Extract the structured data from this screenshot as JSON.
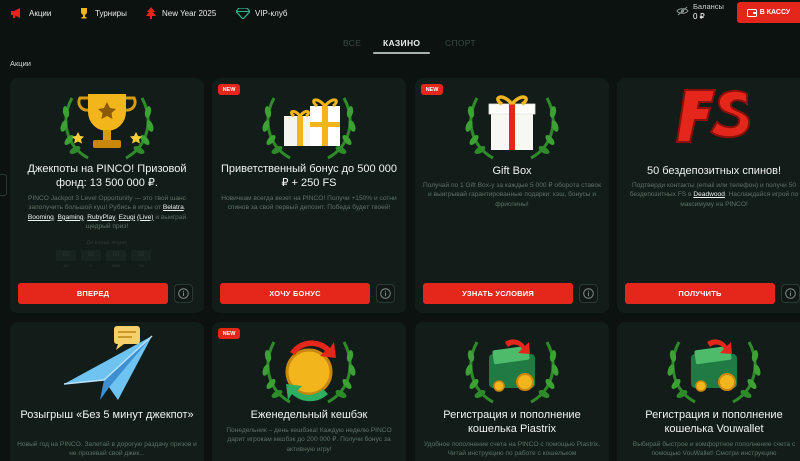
{
  "nav": {
    "items": [
      {
        "label": "Акции",
        "icon": "megaphone-icon"
      },
      {
        "label": "Турниры",
        "icon": "trophy-icon"
      },
      {
        "label": "New Year 2025",
        "icon": "christmas-tree-icon"
      },
      {
        "label": "VIP-клуб",
        "icon": "diamond-icon"
      }
    ],
    "balance_label": "Балансы",
    "balance_value": "0 ₽",
    "cashier_label": "В КАССУ"
  },
  "tabs": [
    {
      "label": "ВСЕ",
      "active": false
    },
    {
      "label": "КАЗИНО",
      "active": true
    },
    {
      "label": "СПОРТ",
      "active": false
    }
  ],
  "section_title": "Акции",
  "cards": [
    {
      "badge": "",
      "art": "gold-trophy-wreath-icon",
      "title": "Джекпоты на PINCO! Призовой фонд: 13 500 000 ₽.",
      "desc_1": "PINCO Jackpot 3 Level Opportunity — это твой шанс заполучить большой куш! Рубись в игры от",
      "links": [
        "Belatra",
        "Booming",
        "Bgaming",
        "RubyPlay",
        "Ezugi"
      ],
      "link_live": "(Live)",
      "desc_2": "и выиграй щедрый приз!",
      "ends_label": "До конца акции:",
      "timer": [
        {
          "value": "00",
          "unit": "дн"
        },
        {
          "value": "00",
          "unit": "ч"
        },
        {
          "value": "00",
          "unit": "мин"
        },
        {
          "value": "00",
          "unit": "сек"
        }
      ],
      "button": "ВПЕРЕД"
    },
    {
      "badge": "NEW",
      "art": "gift-boxes-wreath-icon",
      "title": "Приветственный бонус до 500 000 ₽ + 250 FS",
      "desc": "Новичкам всегда везет на PINCO! Получи +150% и сотни спинов за свой первый депозит. Победа будет твоей!",
      "button": "ХОЧУ БОНУС"
    },
    {
      "badge": "NEW",
      "art": "gift-box-wreath-icon",
      "title": "Gift Box",
      "desc": "Получай по 1 Gift Box-у за каждые 5 000 ₽ оборота ставок и выигрывай гарантированные подарки: кэш, бонусы и фриспины!",
      "button": "УЗНАТЬ УСЛОВИЯ"
    },
    {
      "badge": "",
      "art": "free-spins-fs-icon",
      "title": "50 бездепозитных спинов!",
      "desc": "Подтверди контакты (email или телефон) и получи 50 бездепозитных FS в",
      "link": "Deadwood",
      "desc_end": "Наслаждайся игрой по максимуму на PINCO!",
      "button": "ПОЛУЧИТЬ"
    },
    {
      "badge": "",
      "art": "paper-plane-icon",
      "title": "Розыгрыш «Без 5 минут джекпот»",
      "desc": "Новый год на PINCO. Залетай в дорогую раздачу призов и не прозевай свой джек..."
    },
    {
      "badge": "NEW",
      "art": "cashback-coin-wreath-icon",
      "title": "Еженедельный кешбэк",
      "desc": "Понедельник – день кешбэка! Каждую неделю PINCO дарит игрокам кешбэк до 200 000 ₽. Получи бонус за активную игру!"
    },
    {
      "badge": "",
      "art": "wallet-money-wreath-icon",
      "title": "Регистрация и пополнение кошелька Piastrix",
      "desc": "Удобное пополнение счета на PINCO с помощью Piastrix. Читай инструкцию по работе с кошельком"
    },
    {
      "badge": "",
      "art": "wallet-money-wreath-icon",
      "title": "Регистрация и пополнение кошелька Vouwallet",
      "desc": "Выбирай быстрое и комфортное пополнение счета с помощью VouWallet! Смотри инструкцию"
    }
  ],
  "colors": {
    "accent": "#e5261a",
    "background": "#0b1210",
    "card": "#121d19",
    "wreath": "#2f8a2a",
    "gold": "#f2b51c"
  }
}
